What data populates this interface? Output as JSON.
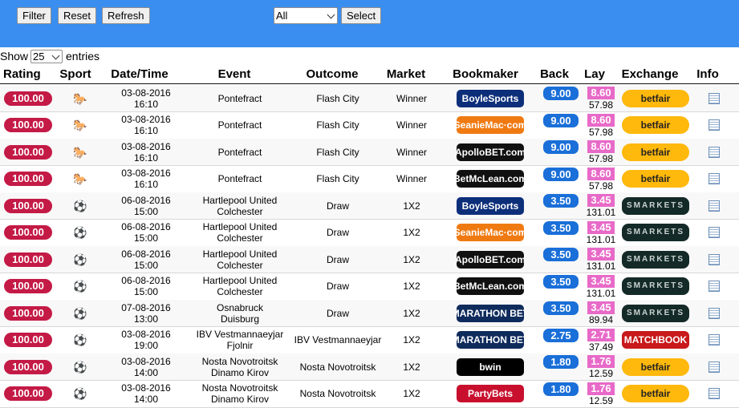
{
  "toolbar": {
    "filter_label": "Filter",
    "reset_label": "Reset",
    "refresh_label": "Refresh",
    "select_value": "All",
    "select_label": "Select",
    "bg_color": "#3a8ef0"
  },
  "show": {
    "prefix": "Show",
    "value": "25",
    "suffix": "entries"
  },
  "columns": [
    "Rating",
    "Sport",
    "Date/Time",
    "Event",
    "Outcome",
    "Market",
    "Bookmaker",
    "Back",
    "Lay",
    "Exchange",
    "Info"
  ],
  "rows": [
    {
      "rating": "100.00",
      "sport": "horse-icon",
      "date": "03-08-2016",
      "time": "16:10",
      "event1": "Pontefract",
      "event2": "",
      "outcome": "Flash City",
      "market": "Winner",
      "bookmaker": "BoyleSports",
      "bm_color": "#0d2f7a",
      "back": "9.00",
      "lay": "8.60",
      "lay_sub": "57.98",
      "exchange": "betfair",
      "ex_class": "ex-betfair"
    },
    {
      "rating": "100.00",
      "sport": "horse-icon",
      "date": "03-08-2016",
      "time": "16:10",
      "event1": "Pontefract",
      "event2": "",
      "outcome": "Flash City",
      "market": "Winner",
      "bookmaker": "SeanieMac·com",
      "bm_color": "#f07a12",
      "back": "9.00",
      "lay": "8.60",
      "lay_sub": "57.98",
      "exchange": "betfair",
      "ex_class": "ex-betfair"
    },
    {
      "rating": "100.00",
      "sport": "horse-icon",
      "date": "03-08-2016",
      "time": "16:10",
      "event1": "Pontefract",
      "event2": "",
      "outcome": "Flash City",
      "market": "Winner",
      "bookmaker": "ApolloBET.com",
      "bm_color": "#111111",
      "back": "9.00",
      "lay": "8.60",
      "lay_sub": "57.98",
      "exchange": "betfair",
      "ex_class": "ex-betfair"
    },
    {
      "rating": "100.00",
      "sport": "horse-icon",
      "date": "03-08-2016",
      "time": "16:10",
      "event1": "Pontefract",
      "event2": "",
      "outcome": "Flash City",
      "market": "Winner",
      "bookmaker": "BetMcLean.com",
      "bm_color": "#111111",
      "back": "9.00",
      "lay": "8.60",
      "lay_sub": "57.98",
      "exchange": "betfair",
      "ex_class": "ex-betfair"
    },
    {
      "rating": "100.00",
      "sport": "soccer-ball-icon",
      "date": "06-08-2016",
      "time": "15:00",
      "event1": "Hartlepool United",
      "event2": "Colchester",
      "outcome": "Draw",
      "market": "1X2",
      "bookmaker": "BoyleSports",
      "bm_color": "#0d2f7a",
      "back": "3.50",
      "lay": "3.45",
      "lay_sub": "131.01",
      "exchange": "SMARKETS",
      "ex_class": "ex-smarkets"
    },
    {
      "rating": "100.00",
      "sport": "soccer-ball-icon",
      "date": "06-08-2016",
      "time": "15:00",
      "event1": "Hartlepool United",
      "event2": "Colchester",
      "outcome": "Draw",
      "market": "1X2",
      "bookmaker": "SeanieMac·com",
      "bm_color": "#f07a12",
      "back": "3.50",
      "lay": "3.45",
      "lay_sub": "131.01",
      "exchange": "SMARKETS",
      "ex_class": "ex-smarkets"
    },
    {
      "rating": "100.00",
      "sport": "soccer-ball-icon",
      "date": "06-08-2016",
      "time": "15:00",
      "event1": "Hartlepool United",
      "event2": "Colchester",
      "outcome": "Draw",
      "market": "1X2",
      "bookmaker": "ApolloBET.com",
      "bm_color": "#111111",
      "back": "3.50",
      "lay": "3.45",
      "lay_sub": "131.01",
      "exchange": "SMARKETS",
      "ex_class": "ex-smarkets"
    },
    {
      "rating": "100.00",
      "sport": "soccer-ball-icon",
      "date": "06-08-2016",
      "time": "15:00",
      "event1": "Hartlepool United",
      "event2": "Colchester",
      "outcome": "Draw",
      "market": "1X2",
      "bookmaker": "BetMcLean.com",
      "bm_color": "#111111",
      "back": "3.50",
      "lay": "3.45",
      "lay_sub": "131.01",
      "exchange": "SMARKETS",
      "ex_class": "ex-smarkets"
    },
    {
      "rating": "100.00",
      "sport": "soccer-ball-icon",
      "date": "07-08-2016",
      "time": "13:00",
      "event1": "Osnabruck",
      "event2": "Duisburg",
      "outcome": "Draw",
      "market": "1X2",
      "bookmaker": "MARATHON BET",
      "bm_color": "#0e2b5c",
      "back": "3.50",
      "lay": "3.45",
      "lay_sub": "89.94",
      "exchange": "SMARKETS",
      "ex_class": "ex-smarkets"
    },
    {
      "rating": "100.00",
      "sport": "soccer-ball-icon",
      "date": "03-08-2016",
      "time": "19:00",
      "event1": "IBV Vestmannaeyjar",
      "event2": "Fjolnir",
      "outcome": "IBV Vestmannaeyjar",
      "market": "1X2",
      "bookmaker": "MARATHON BET",
      "bm_color": "#0e2b5c",
      "back": "2.75",
      "lay": "2.71",
      "lay_sub": "37.49",
      "exchange": "MATCHBOOK",
      "ex_class": "ex-matchbook"
    },
    {
      "rating": "100.00",
      "sport": "soccer-ball-icon",
      "date": "03-08-2016",
      "time": "14:00",
      "event1": "Nosta Novotroitsk",
      "event2": "Dinamo Kirov",
      "outcome": "Nosta Novotroitsk",
      "market": "1X2",
      "bookmaker": "bwin",
      "bm_color": "#000000",
      "back": "1.80",
      "lay": "1.76",
      "lay_sub": "12.59",
      "exchange": "betfair",
      "ex_class": "ex-betfair"
    },
    {
      "rating": "100.00",
      "sport": "soccer-ball-icon",
      "date": "03-08-2016",
      "time": "14:00",
      "event1": "Nosta Novotroitsk",
      "event2": "Dinamo Kirov",
      "outcome": "Nosta Novotroitsk",
      "market": "1X2",
      "bookmaker": "PartyBets",
      "bm_color": "#c8102e",
      "back": "1.80",
      "lay": "1.76",
      "lay_sub": "12.59",
      "exchange": "betfair",
      "ex_class": "ex-betfair"
    }
  ],
  "colors": {
    "rating": "#c41a46",
    "back": "#1a6fd8",
    "lay": "#e86ac8"
  }
}
